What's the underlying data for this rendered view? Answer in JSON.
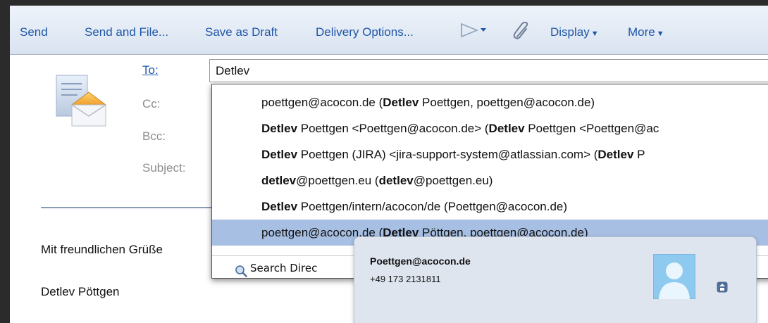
{
  "toolbar": {
    "send": "Send",
    "send_and_file": "Send and File...",
    "save_as_draft": "Save as Draft",
    "delivery_options": "Delivery Options...",
    "display": "Display",
    "more": "More"
  },
  "fields": {
    "to_label": "To:",
    "cc_label": "Cc:",
    "bcc_label": "Bcc:",
    "subject_label": "Subject:",
    "to_value": "Detlev"
  },
  "suggestions": [
    {
      "parts": [
        {
          "t": "poettgen@acocon.de  (",
          "b": false
        },
        {
          "t": "Detlev",
          "b": true
        },
        {
          "t": " Poettgen, poettgen@acocon.de)",
          "b": false
        }
      ]
    },
    {
      "parts": [
        {
          "t": "Detlev",
          "b": true
        },
        {
          "t": " Poettgen <Poettgen@acocon.de>  (",
          "b": false
        },
        {
          "t": "Detlev",
          "b": true
        },
        {
          "t": " Poettgen <Poettgen@ac",
          "b": false
        }
      ]
    },
    {
      "parts": [
        {
          "t": "Detlev",
          "b": true
        },
        {
          "t": " Poettgen (JIRA) <jira-support-system@atlassian.com>  (",
          "b": false
        },
        {
          "t": "Detlev",
          "b": true
        },
        {
          "t": " P",
          "b": false
        }
      ]
    },
    {
      "parts": [
        {
          "t": "detlev",
          "b": true
        },
        {
          "t": "@poettgen.eu  (",
          "b": false
        },
        {
          "t": "detlev",
          "b": true
        },
        {
          "t": "@poettgen.eu)",
          "b": false
        }
      ]
    },
    {
      "parts": [
        {
          "t": "Detlev",
          "b": true
        },
        {
          "t": " Poettgen/intern/acocon/de  (Poettgen@acocon.de)",
          "b": false
        }
      ]
    },
    {
      "parts": [
        {
          "t": "poettgen@acocon.de  (",
          "b": false
        },
        {
          "t": "Detlev",
          "b": true
        },
        {
          "t": " Pöttgen, poettgen@acocon.de)",
          "b": false
        }
      ]
    }
  ],
  "selected_index": 5,
  "search_directory": "Search Direc",
  "body": {
    "greeting": "Mit freundlichen Grüße",
    "signature": "Detlev Pöttgen"
  },
  "card": {
    "email": "Poettgen@acocon.de",
    "phone": "+49 173 2131811"
  },
  "colors": {
    "link": "#1f56a8",
    "selection": "#a7bfe3",
    "card_bg": "#dfe5ef"
  },
  "icons": [
    "compose-mail-icon",
    "flag-icon",
    "paperclip-icon",
    "search-icon",
    "person-avatar-icon",
    "expand-icon"
  ]
}
